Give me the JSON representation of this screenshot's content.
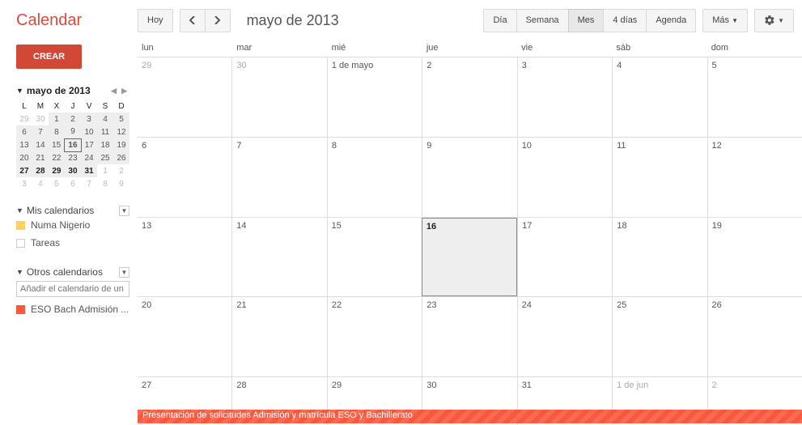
{
  "logo": "Calendar",
  "toolbar": {
    "today": "Hoy",
    "title": "mayo de 2013",
    "views": [
      "Día",
      "Semana",
      "Mes",
      "4 días",
      "Agenda"
    ],
    "active_view": 2,
    "more": "Más"
  },
  "sidebar": {
    "create": "CREAR",
    "mini_cal": {
      "title": "mayo de 2013",
      "dow": [
        "L",
        "M",
        "X",
        "J",
        "V",
        "S",
        "D"
      ],
      "weeks": [
        {
          "bold": false,
          "days": [
            {
              "n": 29,
              "dim": true
            },
            {
              "n": 30,
              "dim": true
            },
            {
              "n": 1,
              "in": true
            },
            {
              "n": 2,
              "in": true
            },
            {
              "n": 3,
              "in": true
            },
            {
              "n": 4,
              "in": true
            },
            {
              "n": 5,
              "in": true
            }
          ]
        },
        {
          "bold": false,
          "days": [
            {
              "n": 6,
              "in": true
            },
            {
              "n": 7,
              "in": true
            },
            {
              "n": 8,
              "in": true
            },
            {
              "n": 9,
              "in": true
            },
            {
              "n": 10,
              "in": true
            },
            {
              "n": 11,
              "in": true
            },
            {
              "n": 12,
              "in": true
            }
          ]
        },
        {
          "bold": false,
          "days": [
            {
              "n": 13,
              "in": true
            },
            {
              "n": 14,
              "in": true
            },
            {
              "n": 15,
              "in": true
            },
            {
              "n": 16,
              "in": true,
              "today": true
            },
            {
              "n": 17,
              "in": true
            },
            {
              "n": 18,
              "in": true
            },
            {
              "n": 19,
              "in": true
            }
          ]
        },
        {
          "bold": false,
          "days": [
            {
              "n": 20,
              "in": true
            },
            {
              "n": 21,
              "in": true
            },
            {
              "n": 22,
              "in": true
            },
            {
              "n": 23,
              "in": true
            },
            {
              "n": 24,
              "in": true
            },
            {
              "n": 25,
              "in": true
            },
            {
              "n": 26,
              "in": true
            }
          ]
        },
        {
          "bold": true,
          "days": [
            {
              "n": 27,
              "in": true
            },
            {
              "n": 28,
              "in": true
            },
            {
              "n": 29,
              "in": true
            },
            {
              "n": 30,
              "in": true
            },
            {
              "n": 31,
              "in": true
            },
            {
              "n": 1,
              "dim": true
            },
            {
              "n": 2,
              "dim": true
            }
          ]
        },
        {
          "bold": false,
          "days": [
            {
              "n": 3,
              "dim": true
            },
            {
              "n": 4,
              "dim": true
            },
            {
              "n": 5,
              "dim": true
            },
            {
              "n": 6,
              "dim": true
            },
            {
              "n": 7,
              "dim": true
            },
            {
              "n": 8,
              "dim": true
            },
            {
              "n": 9,
              "dim": true
            }
          ]
        }
      ]
    },
    "my_cal_title": "Mis calendarios",
    "my_cals": [
      {
        "name": "Numa Nigerio",
        "color": "#fad165"
      },
      {
        "name": "Tareas",
        "color": "#ffffff"
      }
    ],
    "other_cal_title": "Otros calendarios",
    "other_placeholder": "Añadir el calendario de un c",
    "other_cals": [
      {
        "name": "ESO Bach Admisión ...",
        "color": "#fa573c"
      }
    ]
  },
  "grid": {
    "dow": [
      "lun",
      "mar",
      "mié",
      "jue",
      "vie",
      "sáb",
      "dom"
    ],
    "weeks": [
      [
        {
          "label": "29",
          "other": true
        },
        {
          "label": "30",
          "other": true
        },
        {
          "label": "1 de mayo"
        },
        {
          "label": "2"
        },
        {
          "label": "3"
        },
        {
          "label": "4"
        },
        {
          "label": "5"
        }
      ],
      [
        {
          "label": "6"
        },
        {
          "label": "7"
        },
        {
          "label": "8"
        },
        {
          "label": "9"
        },
        {
          "label": "10"
        },
        {
          "label": "11"
        },
        {
          "label": "12"
        }
      ],
      [
        {
          "label": "13"
        },
        {
          "label": "14"
        },
        {
          "label": "15"
        },
        {
          "label": "16",
          "today": true
        },
        {
          "label": "17"
        },
        {
          "label": "18"
        },
        {
          "label": "19"
        }
      ],
      [
        {
          "label": "20"
        },
        {
          "label": "21"
        },
        {
          "label": "22"
        },
        {
          "label": "23"
        },
        {
          "label": "24"
        },
        {
          "label": "25"
        },
        {
          "label": "26"
        }
      ],
      [
        {
          "label": "27"
        },
        {
          "label": "28"
        },
        {
          "label": "29"
        },
        {
          "label": "30"
        },
        {
          "label": "31"
        },
        {
          "label": "1 de jun",
          "other": true
        },
        {
          "label": "2",
          "other": true
        }
      ]
    ],
    "event": {
      "title": "Presentación de solicitudes Admisión y matrícula ESO y Bachillerato",
      "color": "#fa573c"
    }
  }
}
